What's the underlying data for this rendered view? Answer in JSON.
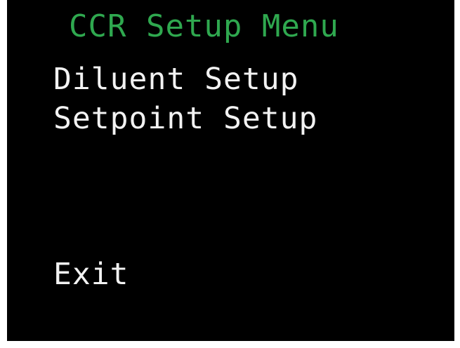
{
  "menu": {
    "title": "CCR Setup Menu",
    "items": [
      {
        "label": "Diluent Setup"
      },
      {
        "label": "Setpoint Setup"
      },
      {
        "label": "Exit"
      }
    ]
  },
  "colors": {
    "background": "#000000",
    "title": "#2fa84f",
    "item_text": "#f2f2f2",
    "border": "#ffffff"
  }
}
